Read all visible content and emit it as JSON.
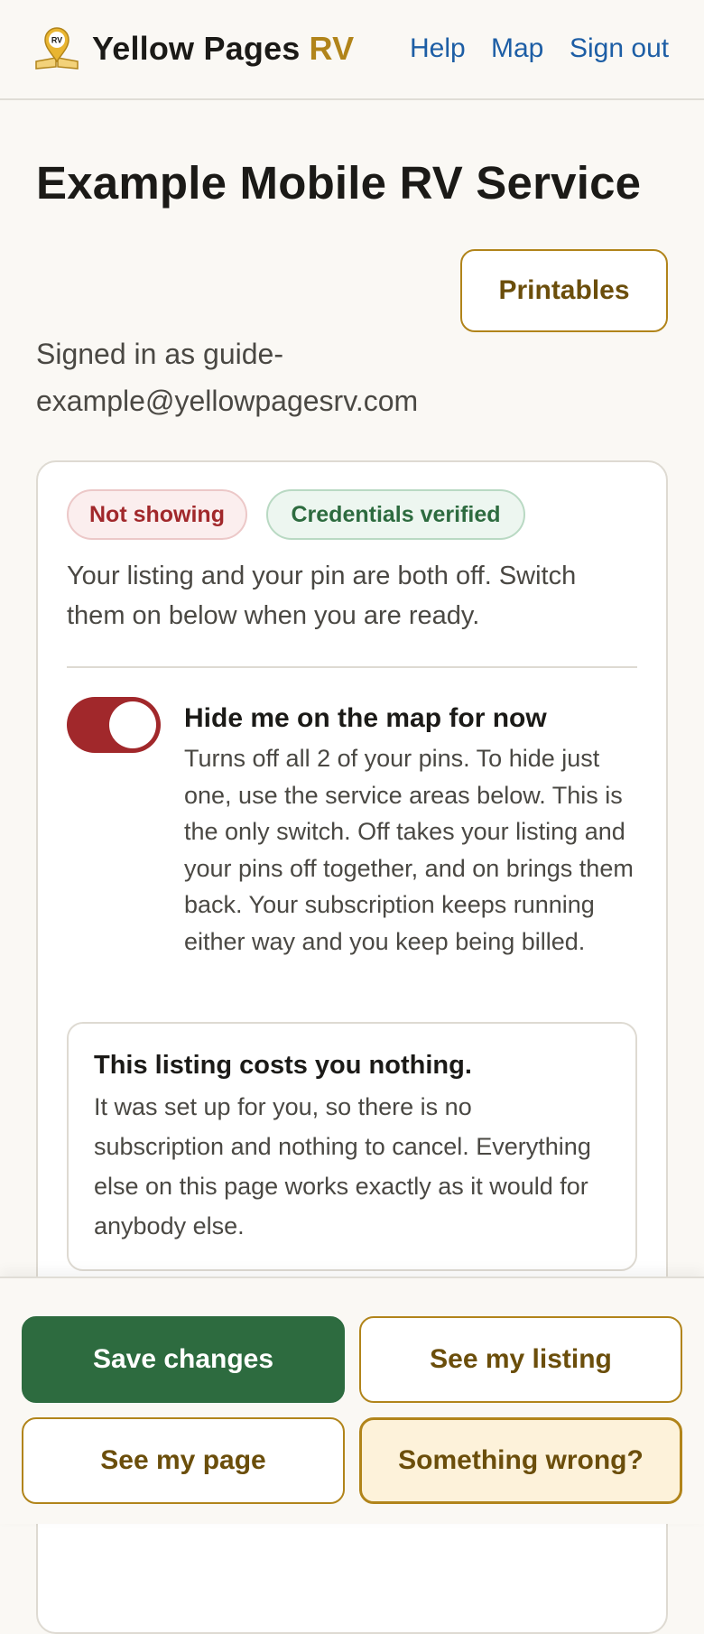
{
  "header": {
    "logo_icon": "map-pin-book-icon",
    "logo_badge": "RV",
    "brand_name": "Yellow Pages",
    "brand_suffix": "RV",
    "nav": {
      "help": "Help",
      "map": "Map",
      "sign_out": "Sign out"
    }
  },
  "page": {
    "title": "Example Mobile RV Service",
    "printables_label": "Printables",
    "signed_in_text": "Signed in as guide-example@yellowpagesrv.com"
  },
  "status_card": {
    "badges": {
      "not_showing": "Not showing",
      "credentials_verified": "Credentials verified"
    },
    "description": "Your listing and your pin are both off. Switch them on below when you are ready.",
    "hide_toggle": {
      "on": true,
      "title": "Hide me on the map for now",
      "description": "Turns off all 2 of your pins. To hide just one, use the service areas below. This is the only switch. Off takes your listing and your pins off together, and on brings them back. Your subscription keeps running either way and you keep being billed."
    },
    "cost_note": {
      "title": "This listing costs you nothing.",
      "description": "It was set up for you, so there is no subscription and nothing to cancel. Everything else on this page works exactly as it would for anybody else."
    }
  },
  "actions": {
    "save": "Save changes",
    "see_listing": "See my listing",
    "see_page": "See my page",
    "something_wrong": "Something wrong?"
  },
  "colors": {
    "brand_gold": "#b1841a",
    "link_blue": "#1d5ea5",
    "danger_red": "#a1282b",
    "success_green": "#2d6b3f",
    "background": "#faf8f4"
  }
}
